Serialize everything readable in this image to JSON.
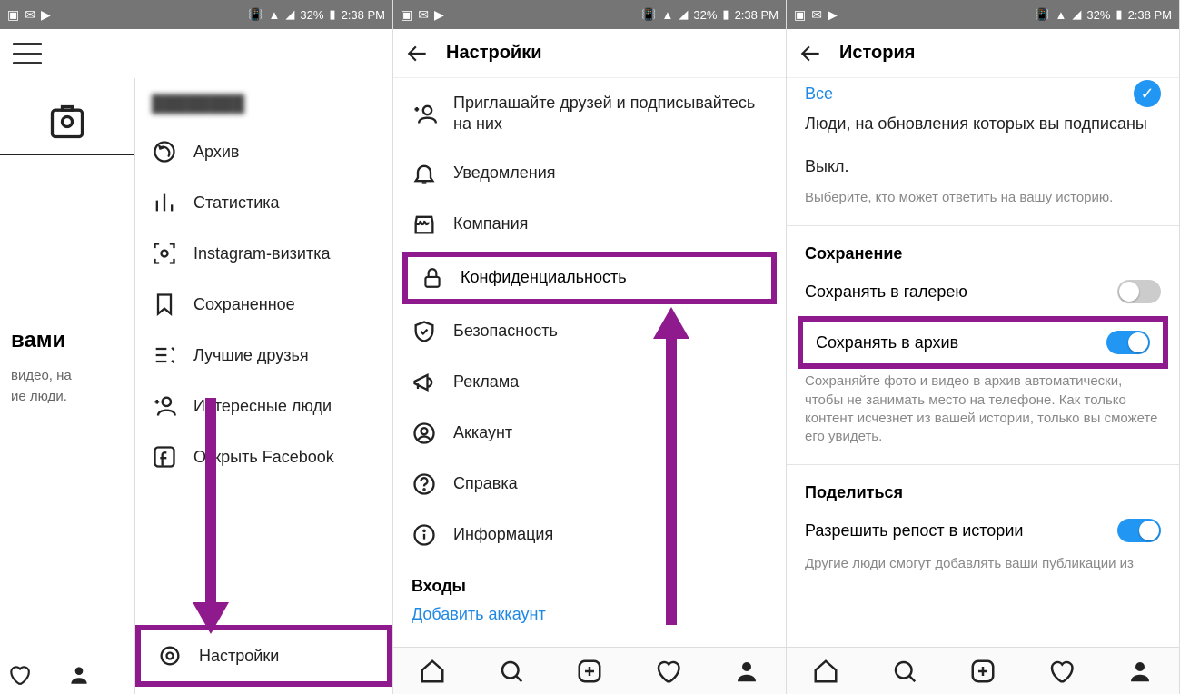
{
  "status": {
    "battery": "32%",
    "time": "2:38 PM"
  },
  "phone1": {
    "strip_title": "вами",
    "strip_sub1": "видео, на",
    "strip_sub2": "ие люди.",
    "items": [
      {
        "label": "Архив"
      },
      {
        "label": "Статистика"
      },
      {
        "label": "Instagram-визитка"
      },
      {
        "label": "Сохраненное"
      },
      {
        "label": "Лучшие друзья"
      },
      {
        "label": "Интересные люди"
      },
      {
        "label": "Открыть Facebook"
      }
    ],
    "settings_label": "Настройки"
  },
  "phone2": {
    "title": "Настройки",
    "items": [
      {
        "label": "Приглашайте друзей и подписывайтесь на них"
      },
      {
        "label": "Уведомления"
      },
      {
        "label": "Компания"
      },
      {
        "label": "Конфиденциальность"
      },
      {
        "label": "Безопасность"
      },
      {
        "label": "Реклама"
      },
      {
        "label": "Аккаунт"
      },
      {
        "label": "Справка"
      },
      {
        "label": "Информация"
      }
    ],
    "logins": "Входы",
    "add_account": "Добавить аккаунт"
  },
  "phone3": {
    "title": "История",
    "top_clip": "Все",
    "subscribed": "Люди, на обновления которых вы подписаны",
    "off": "Выкл.",
    "hint1": "Выберите, кто может ответить на вашу историю.",
    "section_save": "Сохранение",
    "save_gallery": "Сохранять в галерею",
    "save_archive": "Сохранять в архив",
    "hint2": "Сохраняйте фото и видео в архив автоматически, чтобы не занимать место на телефоне. Как только контент исчезнет из вашей истории, только вы сможете его увидеть.",
    "section_share": "Поделиться",
    "allow_repost": "Разрешить репост в истории",
    "hint3": "Другие люди смогут добавлять ваши публикации из"
  }
}
